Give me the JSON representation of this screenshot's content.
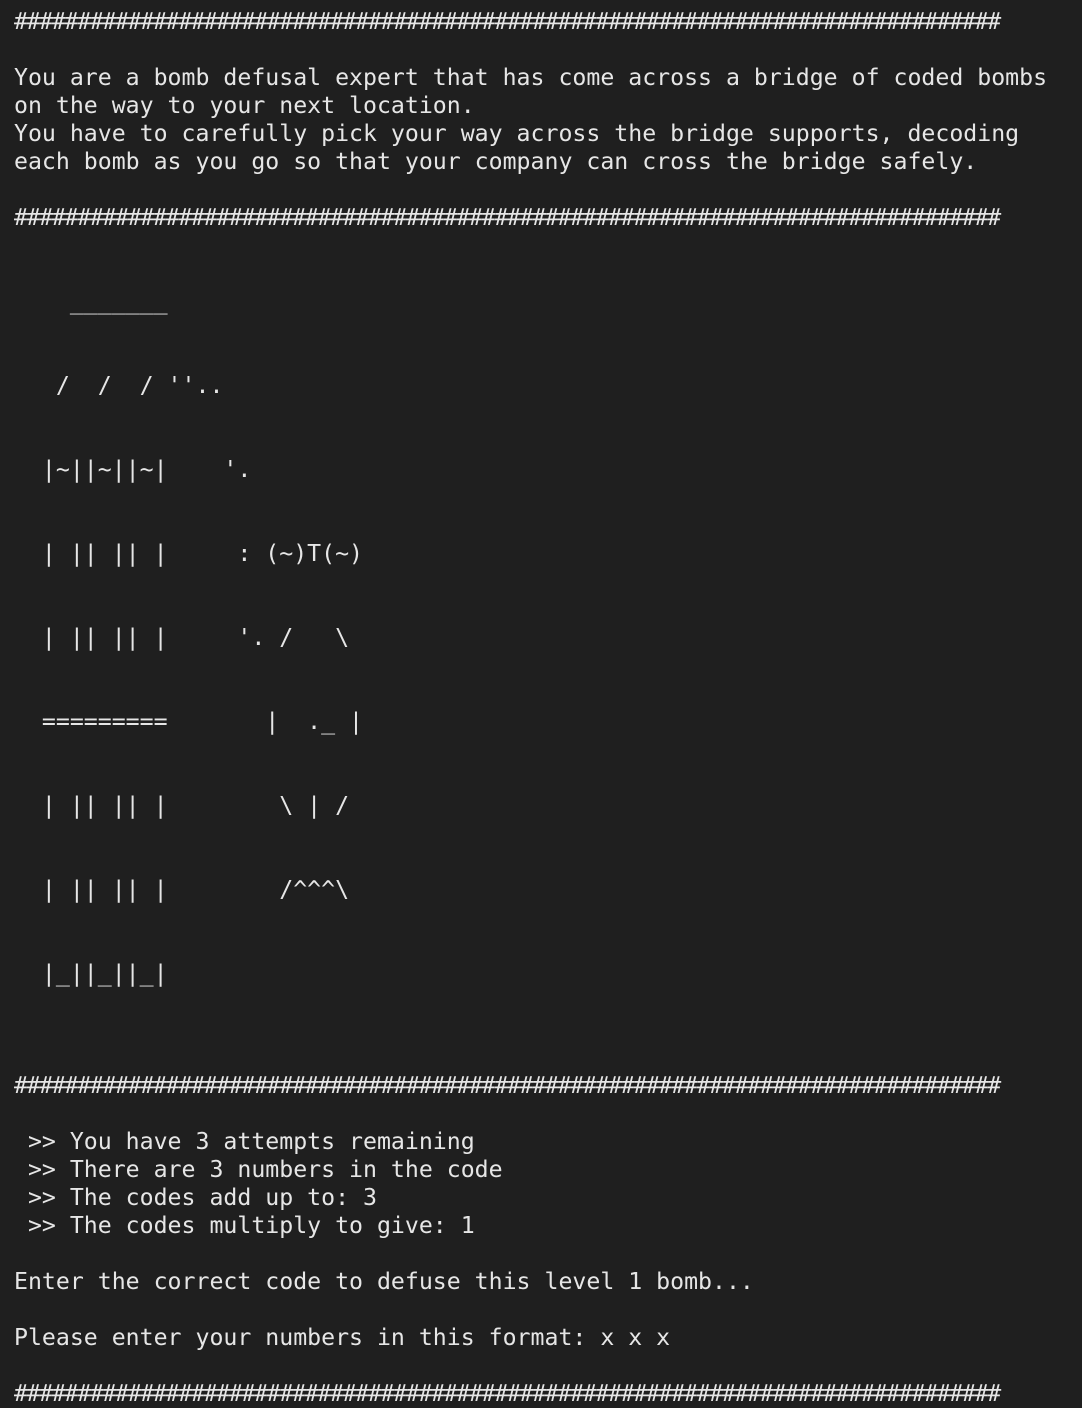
{
  "terminal": {
    "separator": "##############################################################################",
    "intro": [
      "You are a bomb defusal expert that has come across a bridge of coded bombs",
      "on the way to your next location.",
      "You have to carefully pick your way across the bridge supports, decoding",
      "each bomb as you go so that your company can cross the bridge safely."
    ],
    "art": [
      "    _______",
      "   /  /  / ''..",
      "  |~||~||~|    '.",
      "  | || || |     : (~)T(~)",
      "  | || || |     '. /   \\",
      "  =========       |  ._ |",
      "  | || || |        \\ | /",
      "  | || || |        /^^^\\",
      "  |_||_||_|"
    ],
    "status": [
      " >> You have 3 attempts remaining",
      " >> There are 3 numbers in the code",
      " >> The codes add up to: 3",
      " >> The codes multiply to give: 1"
    ],
    "prompt": "Enter the correct code to defuse this level 1 bomb...",
    "format_hint": "Please enter your numbers in this format: x x x"
  }
}
